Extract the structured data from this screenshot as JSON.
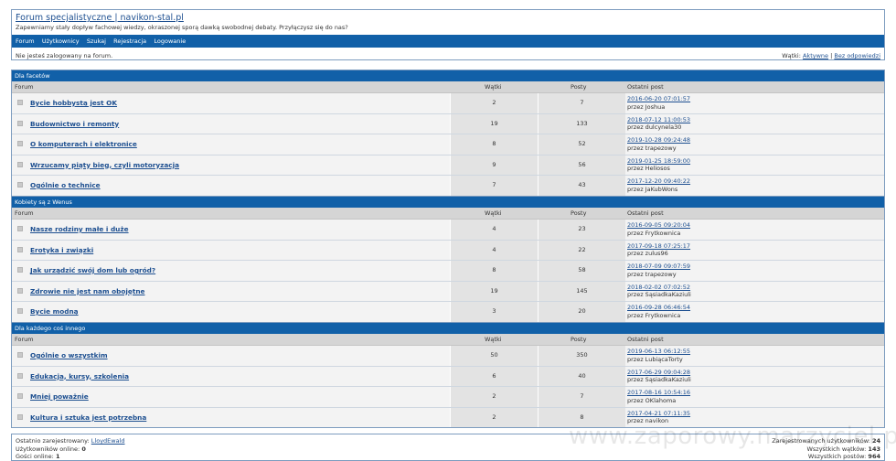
{
  "header": {
    "title": "Forum specjalistyczne | navikon-stal.pl",
    "description": "Zapewniamy stały dopływ fachowej wiedzy, okraszonej sporą dawką swobodnej debaty. Przyłączysz się do nas?",
    "nav": [
      "Forum",
      "Użytkownicy",
      "Szukaj",
      "Rejestracja",
      "Logowanie"
    ],
    "not_logged": "Nie jesteś zalogowany na forum.",
    "topics_label": "Wątki:",
    "topics_active": "Aktywne",
    "topics_sep": "|",
    "topics_unanswered": "Bez odpowiedzi"
  },
  "columns": {
    "forum": "Forum",
    "threads": "Wątki",
    "posts": "Posty",
    "last": "Ostatni post"
  },
  "categories": [
    {
      "title": "Dla facetów",
      "forums": [
        {
          "name": "Bycie hobbystą jest OK",
          "threads": "2",
          "posts": "7",
          "date": "2016-06-20 07:01:57",
          "by": "przez Joshua"
        },
        {
          "name": "Budownictwo i remonty",
          "threads": "19",
          "posts": "133",
          "date": "2018-07-12 11:00:53",
          "by": "przez dulcynela30"
        },
        {
          "name": "O komputerach i elektronice",
          "threads": "8",
          "posts": "52",
          "date": "2019-10-28 09:24:48",
          "by": "przez trapezowy"
        },
        {
          "name": "Wrzucamy piąty bieg, czyli motoryzacja",
          "threads": "9",
          "posts": "56",
          "date": "2019-01-25 18:59:00",
          "by": "przez Heliosos"
        },
        {
          "name": "Ogólnie o technice",
          "threads": "7",
          "posts": "43",
          "date": "2017-12-20 09:40:22",
          "by": "przez JaKubWons"
        }
      ]
    },
    {
      "title": "Kobiety są z Wenus",
      "forums": [
        {
          "name": "Nasze rodziny małe i duże",
          "threads": "4",
          "posts": "23",
          "date": "2016-09-05 09:20:04",
          "by": "przez Frytkownica"
        },
        {
          "name": "Erotyka i związki",
          "threads": "4",
          "posts": "22",
          "date": "2017-09-18 07:25:17",
          "by": "przez zulus96"
        },
        {
          "name": "Jak urządzić swój dom lub ogród?",
          "threads": "8",
          "posts": "58",
          "date": "2018-07-09 09:07:59",
          "by": "przez trapezowy"
        },
        {
          "name": "Zdrowie nie jest nam obojętne",
          "threads": "19",
          "posts": "145",
          "date": "2018-02-02 07:02:52",
          "by": "przez SąsiadkaKaziuli"
        },
        {
          "name": "Bycie modną",
          "threads": "3",
          "posts": "20",
          "date": "2016-09-28 06:46:54",
          "by": "przez Frytkownica"
        }
      ]
    },
    {
      "title": "Dla każdego coś innego",
      "forums": [
        {
          "name": "Ogólnie o wszystkim",
          "threads": "50",
          "posts": "350",
          "date": "2019-06-13 06:12:55",
          "by": "przez LubiącaTorty"
        },
        {
          "name": "Edukacja, kursy, szkolenia",
          "threads": "6",
          "posts": "40",
          "date": "2017-06-29 09:04:28",
          "by": "przez SąsiadkaKaziuli"
        },
        {
          "name": "Mniej poważnie",
          "threads": "2",
          "posts": "7",
          "date": "2017-08-16 10:54:16",
          "by": "przez OKlahoma"
        },
        {
          "name": "Kultura i sztuka jest potrzebna",
          "threads": "2",
          "posts": "8",
          "date": "2017-04-21 07:11:35",
          "by": "przez navikon"
        }
      ]
    }
  ],
  "footer": {
    "last_registered_label": "Ostatnio zarejestrowany:",
    "last_registered": "LloydEwald",
    "online_label": "Użytkowników online:",
    "online": "0",
    "guests_label": "Gości online:",
    "guests": "1",
    "registered_label": "Zarejestrowanych użytkowników:",
    "registered": "24",
    "threads_label": "Wszystkich wątków:",
    "threads": "143",
    "posts_label": "Wszystkich postów:",
    "posts": "964"
  },
  "watermark": "www.zaporowy.marzyciel.pl"
}
